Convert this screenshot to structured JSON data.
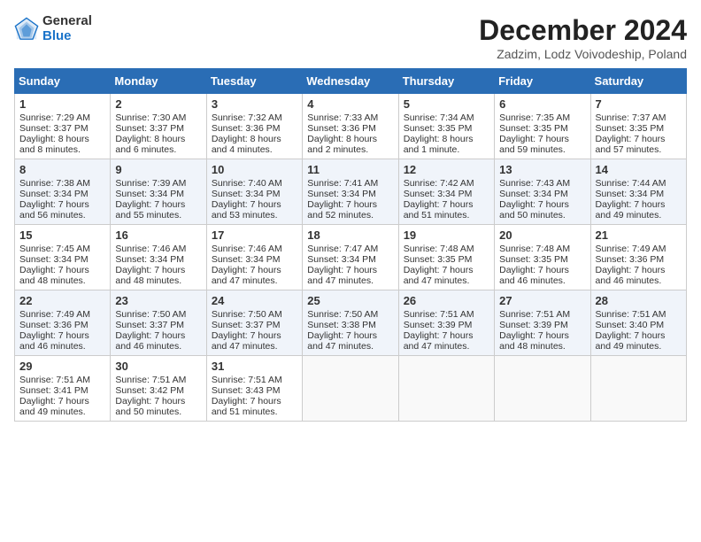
{
  "header": {
    "logo_general": "General",
    "logo_blue": "Blue",
    "title": "December 2024",
    "subtitle": "Zadzim, Lodz Voivodeship, Poland"
  },
  "weekdays": [
    "Sunday",
    "Monday",
    "Tuesday",
    "Wednesday",
    "Thursday",
    "Friday",
    "Saturday"
  ],
  "weeks": [
    [
      {
        "day": "1",
        "sunrise": "Sunrise: 7:29 AM",
        "sunset": "Sunset: 3:37 PM",
        "daylight": "Daylight: 8 hours and 8 minutes."
      },
      {
        "day": "2",
        "sunrise": "Sunrise: 7:30 AM",
        "sunset": "Sunset: 3:37 PM",
        "daylight": "Daylight: 8 hours and 6 minutes."
      },
      {
        "day": "3",
        "sunrise": "Sunrise: 7:32 AM",
        "sunset": "Sunset: 3:36 PM",
        "daylight": "Daylight: 8 hours and 4 minutes."
      },
      {
        "day": "4",
        "sunrise": "Sunrise: 7:33 AM",
        "sunset": "Sunset: 3:36 PM",
        "daylight": "Daylight: 8 hours and 2 minutes."
      },
      {
        "day": "5",
        "sunrise": "Sunrise: 7:34 AM",
        "sunset": "Sunset: 3:35 PM",
        "daylight": "Daylight: 8 hours and 1 minute."
      },
      {
        "day": "6",
        "sunrise": "Sunrise: 7:35 AM",
        "sunset": "Sunset: 3:35 PM",
        "daylight": "Daylight: 7 hours and 59 minutes."
      },
      {
        "day": "7",
        "sunrise": "Sunrise: 7:37 AM",
        "sunset": "Sunset: 3:35 PM",
        "daylight": "Daylight: 7 hours and 57 minutes."
      }
    ],
    [
      {
        "day": "8",
        "sunrise": "Sunrise: 7:38 AM",
        "sunset": "Sunset: 3:34 PM",
        "daylight": "Daylight: 7 hours and 56 minutes."
      },
      {
        "day": "9",
        "sunrise": "Sunrise: 7:39 AM",
        "sunset": "Sunset: 3:34 PM",
        "daylight": "Daylight: 7 hours and 55 minutes."
      },
      {
        "day": "10",
        "sunrise": "Sunrise: 7:40 AM",
        "sunset": "Sunset: 3:34 PM",
        "daylight": "Daylight: 7 hours and 53 minutes."
      },
      {
        "day": "11",
        "sunrise": "Sunrise: 7:41 AM",
        "sunset": "Sunset: 3:34 PM",
        "daylight": "Daylight: 7 hours and 52 minutes."
      },
      {
        "day": "12",
        "sunrise": "Sunrise: 7:42 AM",
        "sunset": "Sunset: 3:34 PM",
        "daylight": "Daylight: 7 hours and 51 minutes."
      },
      {
        "day": "13",
        "sunrise": "Sunrise: 7:43 AM",
        "sunset": "Sunset: 3:34 PM",
        "daylight": "Daylight: 7 hours and 50 minutes."
      },
      {
        "day": "14",
        "sunrise": "Sunrise: 7:44 AM",
        "sunset": "Sunset: 3:34 PM",
        "daylight": "Daylight: 7 hours and 49 minutes."
      }
    ],
    [
      {
        "day": "15",
        "sunrise": "Sunrise: 7:45 AM",
        "sunset": "Sunset: 3:34 PM",
        "daylight": "Daylight: 7 hours and 48 minutes."
      },
      {
        "day": "16",
        "sunrise": "Sunrise: 7:46 AM",
        "sunset": "Sunset: 3:34 PM",
        "daylight": "Daylight: 7 hours and 48 minutes."
      },
      {
        "day": "17",
        "sunrise": "Sunrise: 7:46 AM",
        "sunset": "Sunset: 3:34 PM",
        "daylight": "Daylight: 7 hours and 47 minutes."
      },
      {
        "day": "18",
        "sunrise": "Sunrise: 7:47 AM",
        "sunset": "Sunset: 3:34 PM",
        "daylight": "Daylight: 7 hours and 47 minutes."
      },
      {
        "day": "19",
        "sunrise": "Sunrise: 7:48 AM",
        "sunset": "Sunset: 3:35 PM",
        "daylight": "Daylight: 7 hours and 47 minutes."
      },
      {
        "day": "20",
        "sunrise": "Sunrise: 7:48 AM",
        "sunset": "Sunset: 3:35 PM",
        "daylight": "Daylight: 7 hours and 46 minutes."
      },
      {
        "day": "21",
        "sunrise": "Sunrise: 7:49 AM",
        "sunset": "Sunset: 3:36 PM",
        "daylight": "Daylight: 7 hours and 46 minutes."
      }
    ],
    [
      {
        "day": "22",
        "sunrise": "Sunrise: 7:49 AM",
        "sunset": "Sunset: 3:36 PM",
        "daylight": "Daylight: 7 hours and 46 minutes."
      },
      {
        "day": "23",
        "sunrise": "Sunrise: 7:50 AM",
        "sunset": "Sunset: 3:37 PM",
        "daylight": "Daylight: 7 hours and 46 minutes."
      },
      {
        "day": "24",
        "sunrise": "Sunrise: 7:50 AM",
        "sunset": "Sunset: 3:37 PM",
        "daylight": "Daylight: 7 hours and 47 minutes."
      },
      {
        "day": "25",
        "sunrise": "Sunrise: 7:50 AM",
        "sunset": "Sunset: 3:38 PM",
        "daylight": "Daylight: 7 hours and 47 minutes."
      },
      {
        "day": "26",
        "sunrise": "Sunrise: 7:51 AM",
        "sunset": "Sunset: 3:39 PM",
        "daylight": "Daylight: 7 hours and 47 minutes."
      },
      {
        "day": "27",
        "sunrise": "Sunrise: 7:51 AM",
        "sunset": "Sunset: 3:39 PM",
        "daylight": "Daylight: 7 hours and 48 minutes."
      },
      {
        "day": "28",
        "sunrise": "Sunrise: 7:51 AM",
        "sunset": "Sunset: 3:40 PM",
        "daylight": "Daylight: 7 hours and 49 minutes."
      }
    ],
    [
      {
        "day": "29",
        "sunrise": "Sunrise: 7:51 AM",
        "sunset": "Sunset: 3:41 PM",
        "daylight": "Daylight: 7 hours and 49 minutes."
      },
      {
        "day": "30",
        "sunrise": "Sunrise: 7:51 AM",
        "sunset": "Sunset: 3:42 PM",
        "daylight": "Daylight: 7 hours and 50 minutes."
      },
      {
        "day": "31",
        "sunrise": "Sunrise: 7:51 AM",
        "sunset": "Sunset: 3:43 PM",
        "daylight": "Daylight: 7 hours and 51 minutes."
      },
      null,
      null,
      null,
      null
    ]
  ]
}
